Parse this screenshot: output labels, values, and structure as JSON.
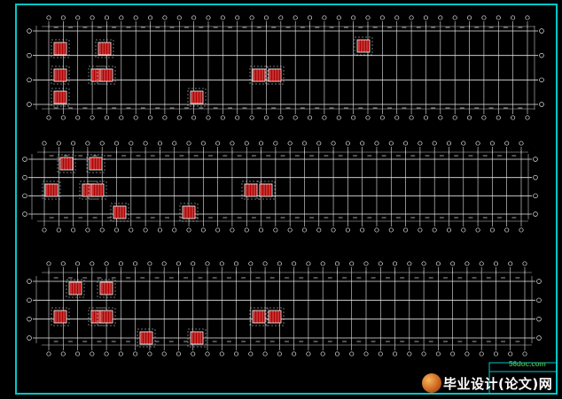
{
  "watermark": {
    "url": "56doc.com",
    "text": "毕业设计(论文)网"
  },
  "colors": {
    "background": "#000000",
    "border": "#00c8c8",
    "grid": "#e8e8e8",
    "dimension": "#c8c8c8",
    "column_fill": "#b00000",
    "column_hatch": "#ffffff"
  },
  "drawing": {
    "plans": [
      {
        "id": "plan-1",
        "name": "floor-plan-top",
        "grid_cols": 34,
        "grid_rows": 4
      },
      {
        "id": "plan-2",
        "name": "floor-plan-middle",
        "grid_cols": 34,
        "grid_rows": 4
      },
      {
        "id": "plan-3",
        "name": "floor-plan-bottom",
        "grid_cols": 34,
        "grid_rows": 4
      }
    ]
  }
}
